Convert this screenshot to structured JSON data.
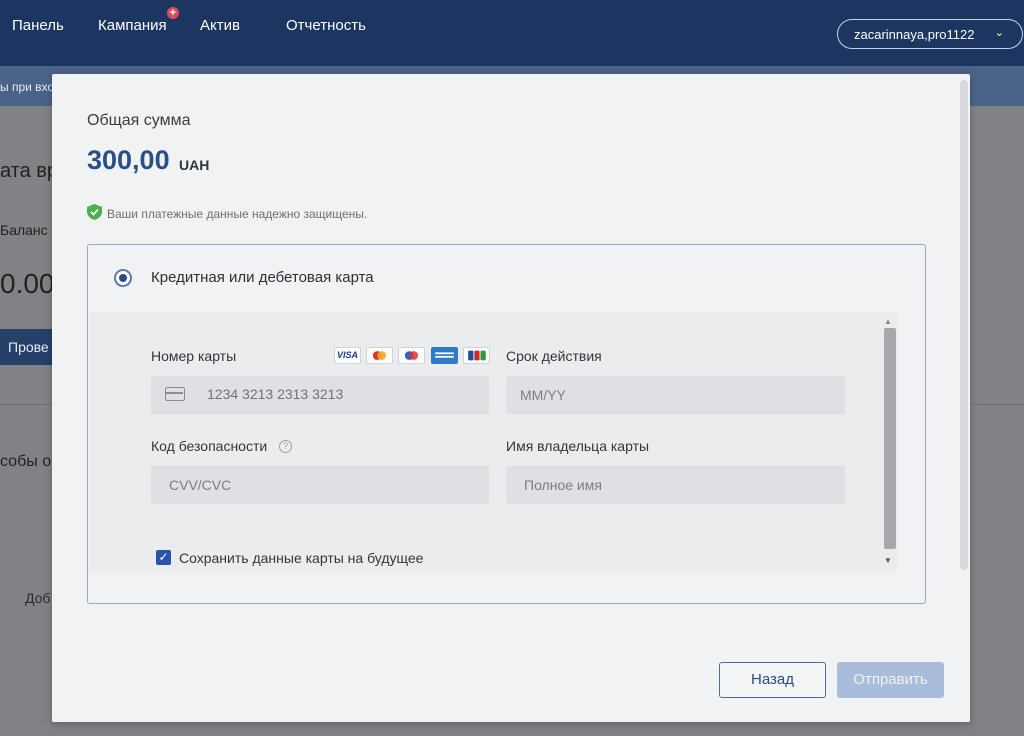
{
  "nav": {
    "items": [
      "Панель",
      "Кампания",
      "Актив",
      "Отчетность"
    ],
    "badge": "+",
    "user": "zacarinnaya,pro1122"
  },
  "background": {
    "notice": "ы при вход",
    "heading": "ата вр",
    "balance_label": "Баланс к",
    "balance_value": "0.00",
    "button": "Прове",
    "methods_heading": "собы о",
    "add_text": "Доб"
  },
  "modal": {
    "total_label": "Общая сумма",
    "amount": "300,00",
    "currency": "UAH",
    "secure_text": "Ваши платежные данные надежно защищены.",
    "method_label": "Кредитная или дебетовая карта",
    "card_number_label": "Номер карты",
    "card_number_value": "1234 3213 2313 3213",
    "expiry_label": "Срок действия",
    "expiry_placeholder": "MM/YY",
    "cvv_label": "Код безопасности",
    "cvv_placeholder": "CVV/CVC",
    "holder_label": "Имя владельца карты",
    "holder_placeholder": "Полное имя",
    "save_card_label": "Сохранить данные карты на будущее",
    "back_button": "Назад",
    "submit_button": "Отправить",
    "card_brands": [
      "visa",
      "mastercard",
      "maestro",
      "amex",
      "jcb"
    ],
    "brand_visa_text": "VISA"
  },
  "colors": {
    "nav_bg": "#1d3561",
    "accent": "#2a4f86",
    "secure_green": "#4caf50",
    "checkbox": "#2855a6"
  }
}
